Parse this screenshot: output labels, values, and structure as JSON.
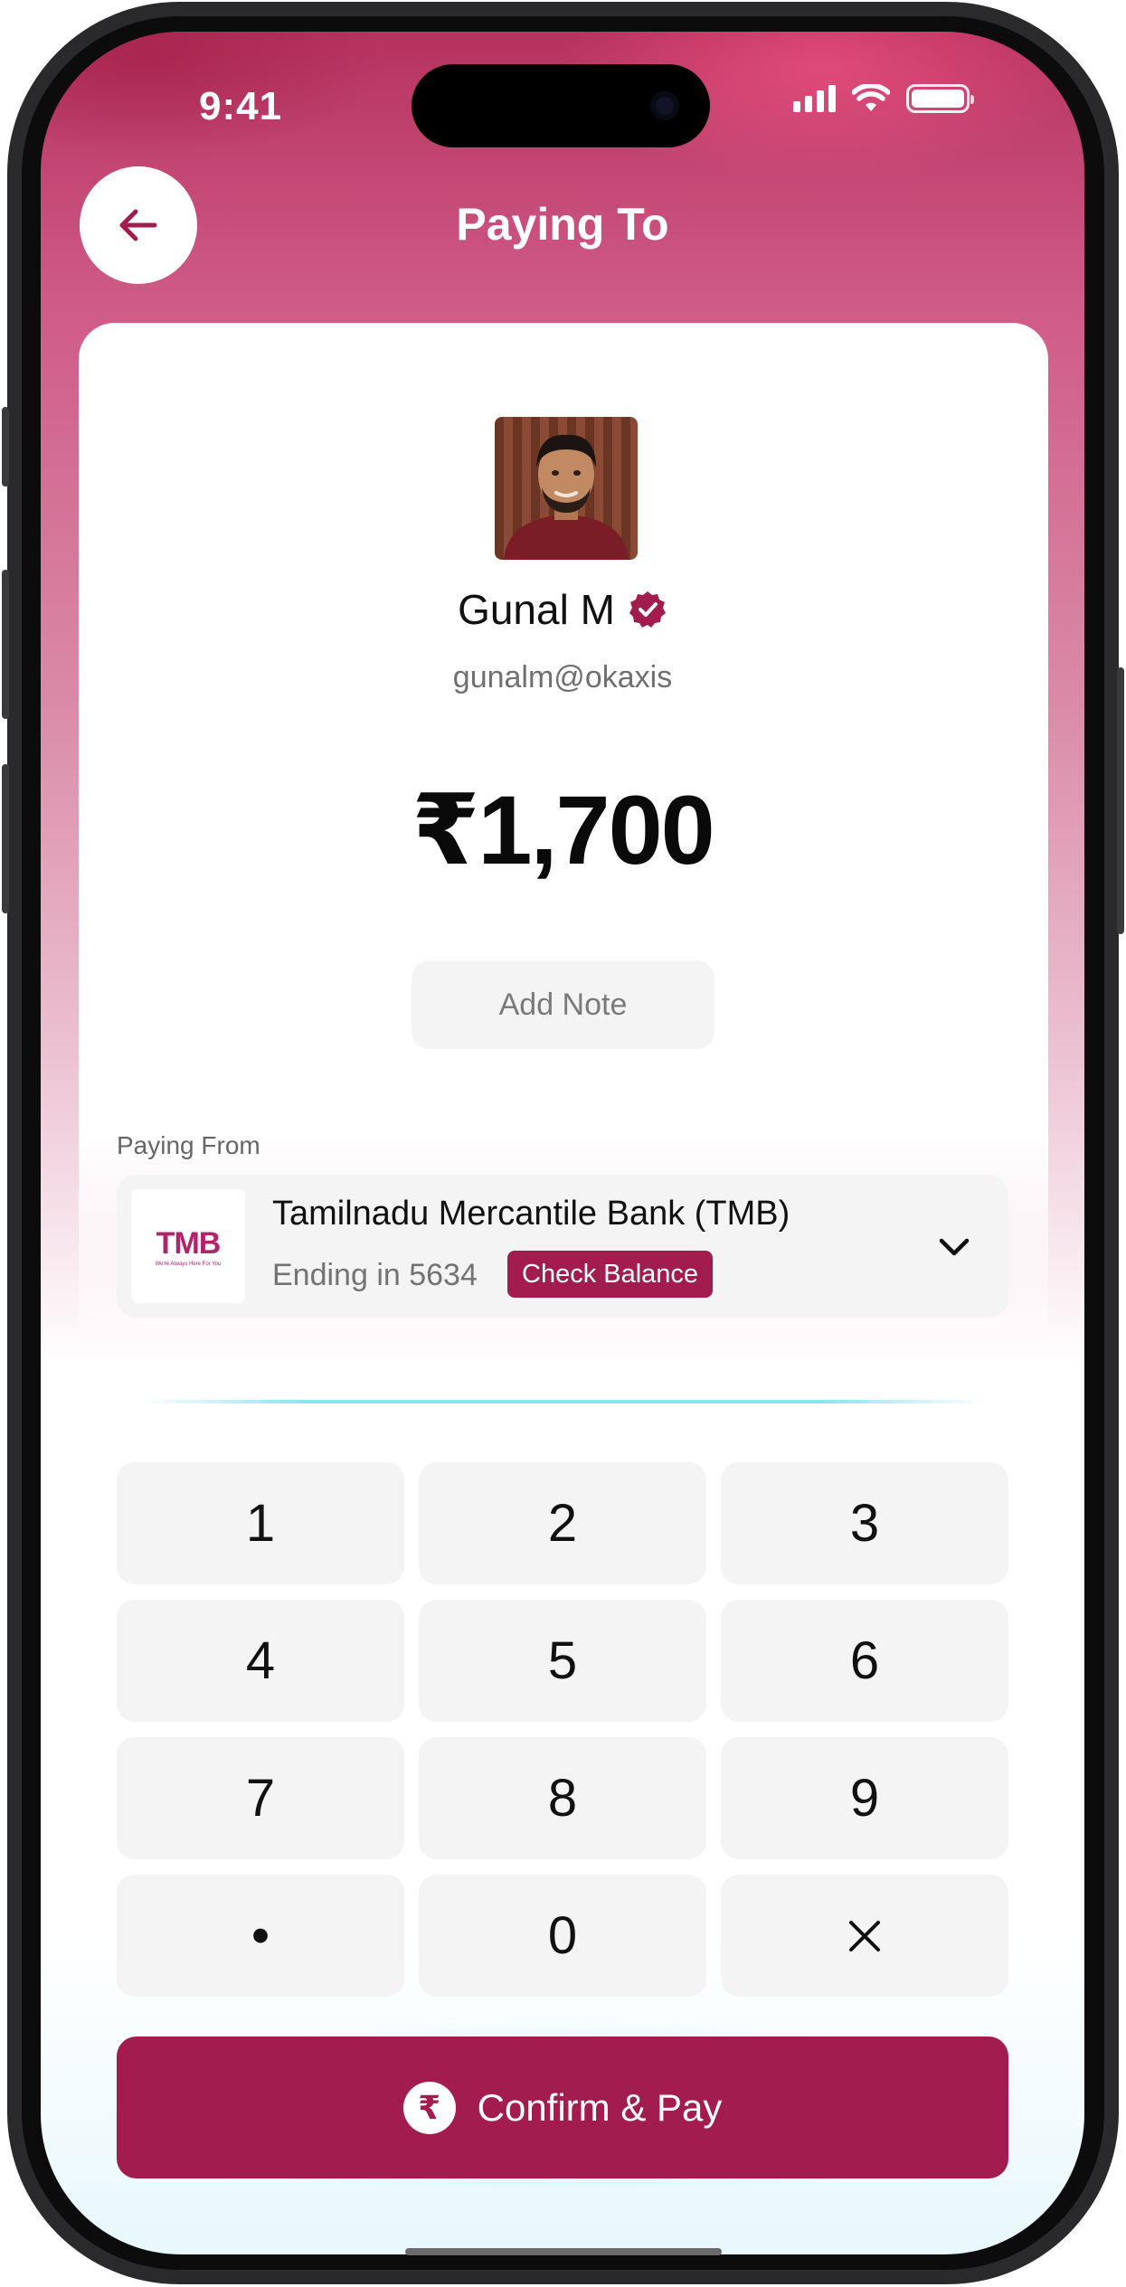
{
  "status_bar": {
    "time": "9:41",
    "icons": [
      "cellular-signal-icon",
      "wifi-icon",
      "battery-icon"
    ]
  },
  "header": {
    "back_icon": "arrow-left-icon",
    "title": "Paying To"
  },
  "payee": {
    "avatar": "payee-photo",
    "name": "Gunal M",
    "verified_icon": "verified-badge-icon",
    "upi_id": "gunalm@okaxis"
  },
  "amount": "₹1,700",
  "note": {
    "label": "Add Note"
  },
  "paying_from": {
    "label": "Paying From",
    "bank_logo_text": "TMB",
    "bank_logo_tagline": "We're Always Here For You",
    "bank_name": "Tamilnadu Mercantile Bank (TMB)",
    "account_ending": "Ending in 5634",
    "check_balance_label": "Check Balance",
    "expand_icon": "chevron-down-icon"
  },
  "keypad": {
    "keys": [
      "1",
      "2",
      "3",
      "4",
      "5",
      "6",
      "7",
      "8",
      "9",
      "•",
      "0",
      "×"
    ]
  },
  "confirm": {
    "icon": "rupee-circle-icon",
    "rupee_symbol": "₹",
    "label": "Confirm & Pay"
  },
  "colors": {
    "brand": "#a21d4d",
    "header_gradient_top": "#b6325f",
    "header_gradient_accent": "#ff5a8c",
    "key_background": "#f4f4f4",
    "divider_accent": "#78dcf0"
  }
}
